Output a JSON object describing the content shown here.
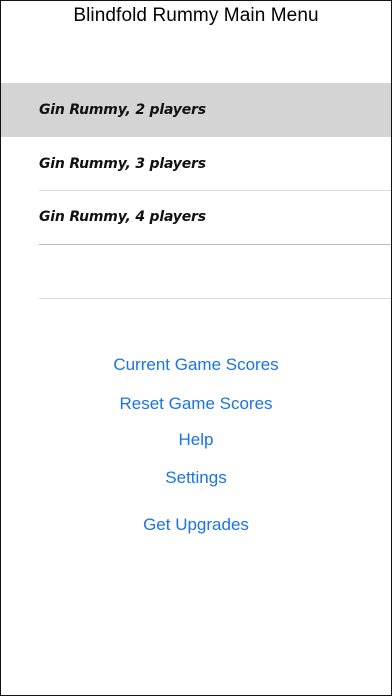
{
  "header": {
    "title": "Blindfold Rummy Main Menu"
  },
  "menu": {
    "items": [
      {
        "label": "Gin Rummy, 2 players"
      },
      {
        "label": "Gin Rummy, 3 players"
      },
      {
        "label": "Gin Rummy, 4 players"
      }
    ],
    "selected_index": 0
  },
  "links": {
    "current_game_scores": "Current Game Scores",
    "reset_game_scores": "Reset Game Scores",
    "help": "Help",
    "settings": "Settings",
    "get_upgrades": "Get Upgrades"
  },
  "colors": {
    "link": "#1a73e8",
    "selected_row": "#d4d4d4",
    "divider": "#dcdcdc"
  }
}
